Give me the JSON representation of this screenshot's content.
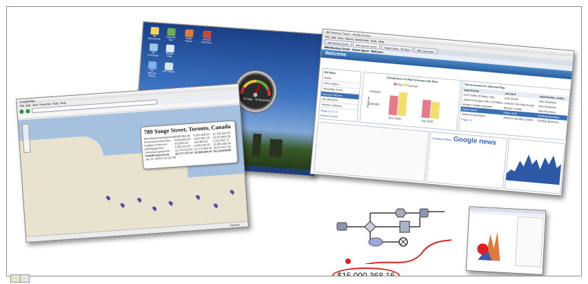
{
  "desktop_window": {
    "icons": [
      "My Documents",
      "Expense Doc",
      "Sales Report",
      "Annual Summary",
      "My Computer",
      "Budget Plan",
      "My Network Places",
      "GIS Import"
    ],
    "gauge": {
      "left_label": "% Total",
      "right_label": "% Received",
      "needle_color": "#d10000"
    }
  },
  "mashup_window": {
    "title": "IBM Mashup Center - Mozilla Firefox",
    "menu": [
      "File",
      "Edit",
      "View",
      "History",
      "Bookmarks",
      "Tools",
      "Help"
    ],
    "tabs": [
      "IBM Mashup Center",
      "IBM Mashup Center",
      "Copper Wave - All Sales",
      "IBM Corporation"
    ],
    "breadcrumb": [
      "IBM Mashup Center",
      "Home Space",
      "Welcome"
    ],
    "heading": "Welcome",
    "reps_panel": {
      "title": "My Reps",
      "items": [
        "Name",
        "Chris Ohlson",
        "Samantha Frost",
        "George Harmon",
        "Joe Bowman",
        "Andrea LaMonte"
      ],
      "selected": 3,
      "pager": "Page 1 | 2 | 3",
      "prev_next": "Previous Next"
    },
    "chart_panel": {
      "title": "Comparison on Rep Forecast with Plan",
      "legend": [
        "Plan",
        "Forecast"
      ],
      "x_ticks": [
        "June 2009",
        "July 2009"
      ],
      "y_ticks": [
        "2000000",
        "1000000"
      ],
      "ylabel": "Revenue",
      "colors": {
        "plan": "#e8798b",
        "forecast": "#f2de6e"
      }
    },
    "accounts_panel": {
      "title": "Top Accounts for Selected Rep",
      "headers": [
        "opportunity",
        "account",
        "opportunity_status"
      ],
      "rows": [
        [
          "Golf Shafts 09 Major Opp",
          "Golf Shafts",
          "New Business"
        ],
        [
          "Judsons Shapers Mfr. Golf Bikes",
          "Judsons Sporting Goods",
          "New Business"
        ],
        [
          "Modern Outfits Upgrade",
          "Modern Outfits",
          "New Business"
        ],
        [
          "Alpine Mach",
          "Alpine Golf",
          "Existing Business"
        ],
        [
          "Judsons Expansion",
          "Judsons Sporting Goods",
          "Existing Business"
        ]
      ],
      "pager": "Page 1 2"
    },
    "news": {
      "label": "Company News",
      "brand": "Google news"
    }
  },
  "gmaps_window": {
    "title": "GoogleMaps",
    "menu": [
      "File",
      "Edit",
      "View",
      "Favorites",
      "Tools",
      "Help"
    ],
    "popup_title": "789 Yonge Street, Toronto, Canada",
    "popup_rows": [
      [
        "Manufacturing Equipment",
        "3,853,852.00",
        "9,503,828.00",
        "12,753,314.00"
      ],
      [
        "Personal Accessories",
        "4,655,568.00",
        "4,832,251.00",
        "13,913,906.38"
      ],
      [
        "Outdoor Protection",
        "203,826.00",
        "136,369.00",
        "2,021,951.71"
      ],
      [
        "Golf Equipment",
        "5,863,114.00",
        "5,546,032.00",
        "15,891,555.00"
      ],
      [
        "Camping Equipment",
        "13,373,203.00",
        "12,473,395.00",
        "34,614,617.32"
      ],
      [
        "Total(Product line)",
        "33,717,737.00",
        "33,926,904.00",
        "83,116,808.80"
      ]
    ],
    "popup_date": "Jan 12, 2009 2:30:26 PM",
    "status": "Internet"
  },
  "flow": {
    "amount": "$15,000,368.16"
  },
  "caption": {
    "text": "pes"
  }
}
